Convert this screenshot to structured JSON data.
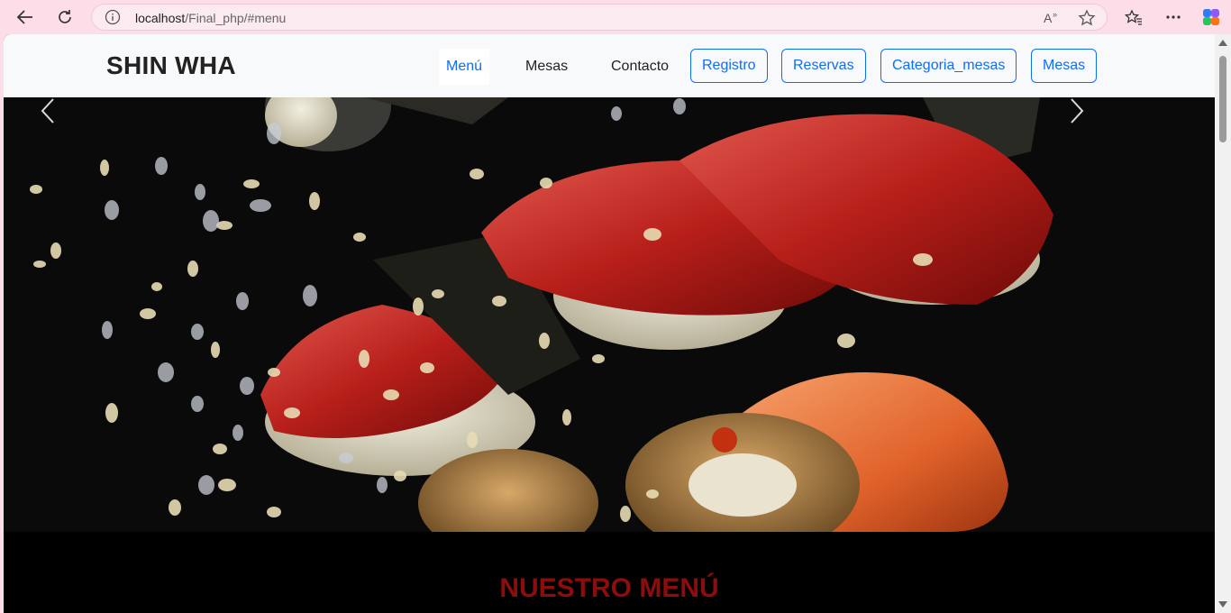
{
  "browser": {
    "url_host": "localhost",
    "url_path": "/Final_php/#menu"
  },
  "navbar": {
    "brand": "SHIN WHA",
    "links": [
      {
        "label": "Menú",
        "active": true
      },
      {
        "label": "Mesas",
        "active": false
      },
      {
        "label": "Contacto",
        "active": false
      }
    ],
    "buttons": [
      {
        "label": "Registro"
      },
      {
        "label": "Reservas"
      },
      {
        "label": "Categoria_mesas"
      },
      {
        "label": "Mesas"
      }
    ],
    "accent_color": "#0d6efd"
  },
  "carousel": {
    "image": "sushi-photo",
    "prev_icon": "chevron-left-icon",
    "next_icon": "chevron-right-icon"
  },
  "menu_section": {
    "title": "NUESTRO MENÚ",
    "title_color": "#8b0d0d"
  }
}
